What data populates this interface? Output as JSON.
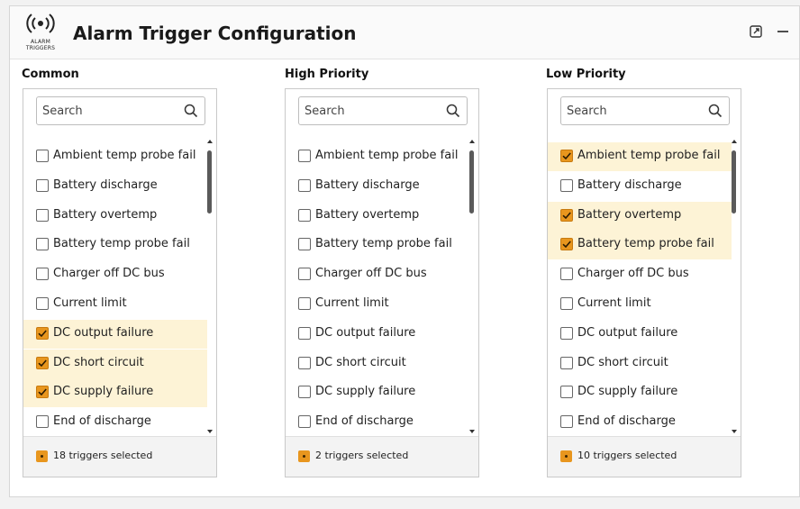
{
  "app": {
    "title": "Alarm Trigger Configuration",
    "logo_text": "ALARM TRIGGERS",
    "accent": "#e8961e",
    "selected_bg": "#fdf3d6"
  },
  "panels": [
    {
      "label": "Common",
      "search_placeholder": "Search",
      "footer": "18 triggers selected",
      "items": [
        {
          "label": "Ambient temp probe fail",
          "checked": false
        },
        {
          "label": "Battery discharge",
          "checked": false
        },
        {
          "label": "Battery overtemp",
          "checked": false
        },
        {
          "label": "Battery temp probe fail",
          "checked": false
        },
        {
          "label": "Charger off DC bus",
          "checked": false
        },
        {
          "label": "Current limit",
          "checked": false
        },
        {
          "label": "DC output failure",
          "checked": true
        },
        {
          "label": "DC short circuit",
          "checked": true
        },
        {
          "label": "DC supply failure",
          "checked": true
        },
        {
          "label": "End of discharge",
          "checked": false
        }
      ]
    },
    {
      "label": "High Priority",
      "search_placeholder": "Search",
      "footer": "2 triggers selected",
      "items": [
        {
          "label": "Ambient temp probe fail",
          "checked": false
        },
        {
          "label": "Battery discharge",
          "checked": false
        },
        {
          "label": "Battery overtemp",
          "checked": false
        },
        {
          "label": "Battery temp probe fail",
          "checked": false
        },
        {
          "label": "Charger off DC bus",
          "checked": false
        },
        {
          "label": "Current limit",
          "checked": false
        },
        {
          "label": "DC output failure",
          "checked": false
        },
        {
          "label": "DC short circuit",
          "checked": false
        },
        {
          "label": "DC supply failure",
          "checked": false
        },
        {
          "label": "End of discharge",
          "checked": false
        }
      ]
    },
    {
      "label": "Low Priority",
      "search_placeholder": "Search",
      "footer": "10 triggers selected",
      "items": [
        {
          "label": "Ambient temp probe fail",
          "checked": true
        },
        {
          "label": "Battery discharge",
          "checked": false
        },
        {
          "label": "Battery overtemp",
          "checked": true
        },
        {
          "label": "Battery temp probe fail",
          "checked": true
        },
        {
          "label": "Charger off DC bus",
          "checked": false
        },
        {
          "label": "Current limit",
          "checked": false
        },
        {
          "label": "DC output failure",
          "checked": false
        },
        {
          "label": "DC short circuit",
          "checked": false
        },
        {
          "label": "DC supply failure",
          "checked": false
        },
        {
          "label": "End of discharge",
          "checked": false
        }
      ]
    }
  ]
}
